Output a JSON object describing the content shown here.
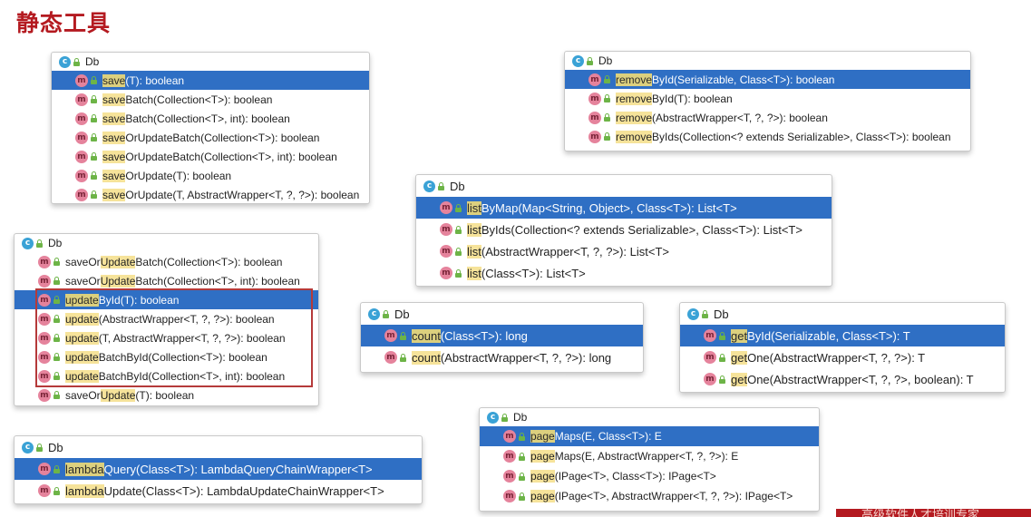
{
  "page_title": "静态工具",
  "banner_text": "高级软件人才培训专家",
  "icons": {
    "class_icon": "c",
    "method_icon": "m"
  },
  "colors": {
    "selected_row": "#2f6fc4",
    "match_highlight": "#f6e39a",
    "title_red": "#b41a20"
  },
  "popups": {
    "save": {
      "header": "Db",
      "rows": [
        {
          "hl": "save",
          "rest": "(T): boolean"
        },
        {
          "hl": "save",
          "rest": "Batch(Collection<T>): boolean"
        },
        {
          "hl": "save",
          "rest": "Batch(Collection<T>, int): boolean"
        },
        {
          "hl": "save",
          "rest": "OrUpdateBatch(Collection<T>): boolean"
        },
        {
          "hl": "save",
          "rest": "OrUpdateBatch(Collection<T>, int): boolean"
        },
        {
          "hl": "save",
          "rest": "OrUpdate(T): boolean"
        },
        {
          "hl": "save",
          "rest": "OrUpdate(T, AbstractWrapper<T, ?, ?>): boolean"
        }
      ]
    },
    "update": {
      "header": "Db",
      "rows": [
        {
          "pre": "saveOr",
          "hl": "Update",
          "rest": "Batch(Collection<T>): boolean"
        },
        {
          "pre": "saveOr",
          "hl": "Update",
          "rest": "Batch(Collection<T>, int): boolean"
        },
        {
          "pre": "",
          "hl": "update",
          "rest": "ById(T): boolean"
        },
        {
          "pre": "",
          "hl": "update",
          "rest": "(AbstractWrapper<T, ?, ?>): boolean"
        },
        {
          "pre": "",
          "hl": "update",
          "rest": "(T, AbstractWrapper<T, ?, ?>): boolean"
        },
        {
          "pre": "",
          "hl": "update",
          "rest": "BatchById(Collection<T>): boolean"
        },
        {
          "pre": "",
          "hl": "update",
          "rest": "BatchById(Collection<T>, int): boolean"
        },
        {
          "pre": "saveOr",
          "hl": "Update",
          "rest": "(T): boolean"
        }
      ]
    },
    "lambda": {
      "header": "Db",
      "rows": [
        {
          "hl": "lambda",
          "rest": "Query(Class<T>): LambdaQueryChainWrapper<T>"
        },
        {
          "hl": "lambda",
          "rest": "Update(Class<T>): LambdaUpdateChainWrapper<T>"
        }
      ]
    },
    "remove": {
      "header": "Db",
      "rows": [
        {
          "hl": "remove",
          "rest": "ById(Serializable, Class<T>): boolean"
        },
        {
          "hl": "remove",
          "rest": "ById(T): boolean"
        },
        {
          "hl": "remove",
          "rest": "(AbstractWrapper<T, ?, ?>): boolean"
        },
        {
          "hl": "remove",
          "rest": "ByIds(Collection<? extends Serializable>, Class<T>): boolean"
        }
      ]
    },
    "list": {
      "header": "Db",
      "rows": [
        {
          "hl": "list",
          "rest": "ByMap(Map<String, Object>, Class<T>): List<T>"
        },
        {
          "hl": "list",
          "rest": "ByIds(Collection<? extends Serializable>, Class<T>): List<T>"
        },
        {
          "hl": "list",
          "rest": "(AbstractWrapper<T, ?, ?>): List<T>"
        },
        {
          "hl": "list",
          "rest": "(Class<T>): List<T>"
        }
      ]
    },
    "count": {
      "header": "Db",
      "rows": [
        {
          "hl": "count",
          "rest": "(Class<T>): long"
        },
        {
          "hl": "count",
          "rest": "(AbstractWrapper<T, ?, ?>): long"
        }
      ]
    },
    "get": {
      "header": "Db",
      "rows": [
        {
          "hl": "get",
          "rest": "ById(Serializable, Class<T>): T"
        },
        {
          "hl": "get",
          "rest": "One(AbstractWrapper<T, ?, ?>): T"
        },
        {
          "hl": "get",
          "rest": "One(AbstractWrapper<T, ?, ?>, boolean): T"
        }
      ]
    },
    "page": {
      "header": "Db",
      "rows": [
        {
          "hl": "page",
          "rest": "Maps(E, Class<T>): E"
        },
        {
          "hl": "page",
          "rest": "Maps(E, AbstractWrapper<T, ?, ?>): E"
        },
        {
          "hl": "page",
          "rest": "(IPage<T>, Class<T>): IPage<T>"
        },
        {
          "hl": "page",
          "rest": "(IPage<T>, AbstractWrapper<T, ?, ?>): IPage<T>"
        }
      ]
    }
  }
}
